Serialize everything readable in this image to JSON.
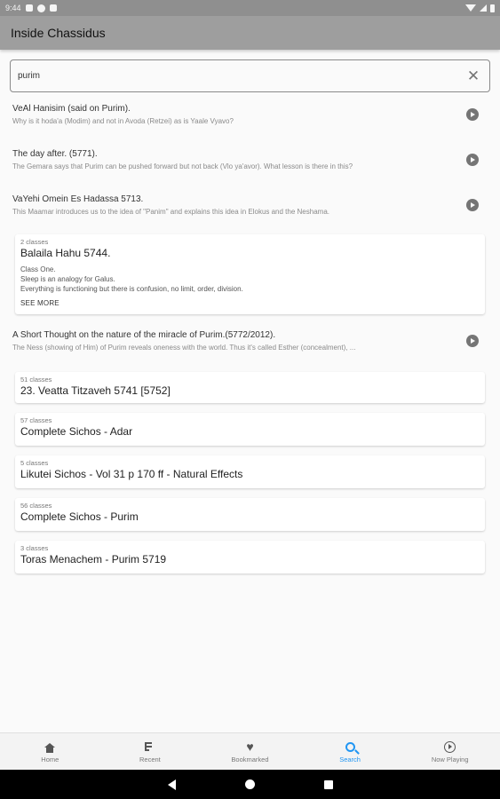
{
  "status_bar": {
    "time": "9:44"
  },
  "app_bar": {
    "title": "Inside Chassidus"
  },
  "search": {
    "value": "purim"
  },
  "results": [
    {
      "kind": "item",
      "title": "VeAl Hanisim (said on Purim).",
      "subtitle": "Why is it hoda'a (Modim) and not in Avoda (Retzei) as is Yaale Vyavo?"
    },
    {
      "kind": "item",
      "title": "The day after. (5771).",
      "subtitle": "The Gemara says that Purim can be pushed forward but not back (Vlo ya'avor). What lesson is there in this?"
    },
    {
      "kind": "item",
      "title": "VaYehi Omein Es Hadassa 5713.",
      "subtitle": "This Maamar introduces us to the idea of \"Panim\" and explains this idea in Elokus and the Neshama."
    },
    {
      "kind": "card",
      "count": "2 classes",
      "title": "Balaila Hahu 5744.",
      "lines": [
        "Class One.",
        "Sleep is an analogy for Galus.",
        "Everything is functioning but there is confusion, no limit, order, division."
      ],
      "see_more": "SEE MORE"
    },
    {
      "kind": "item",
      "title": "A Short Thought on the nature of the miracle of Purim.(5772/2012).",
      "subtitle": "The Ness (showing of Him) of Purim reveals oneness with the world. Thus it's called Esther (concealment), ..."
    },
    {
      "kind": "card",
      "count": "51 classes",
      "title": "23. Veatta Titzaveh 5741 [5752]"
    },
    {
      "kind": "card",
      "count": "57 classes",
      "title": "Complete Sichos - Adar"
    },
    {
      "kind": "card",
      "count": "5 classes",
      "title": "Likutei Sichos - Vol 31 p 170 ff - Natural Effects"
    },
    {
      "kind": "card",
      "count": "56 classes",
      "title": "Complete Sichos - Purim"
    },
    {
      "kind": "card",
      "count": "3 classes",
      "title": "Toras Menachem - Purim 5719"
    }
  ],
  "bottom_nav": [
    {
      "label": "Home",
      "icon": "home-icon"
    },
    {
      "label": "Recent",
      "icon": "recent-icon"
    },
    {
      "label": "Bookmarked",
      "icon": "heart-icon"
    },
    {
      "label": "Search",
      "icon": "search-icon",
      "active": true
    },
    {
      "label": "Now Playing",
      "icon": "now-playing-icon"
    }
  ],
  "colors": {
    "accent": "#2196f3",
    "app_bar": "#9e9e9e"
  }
}
